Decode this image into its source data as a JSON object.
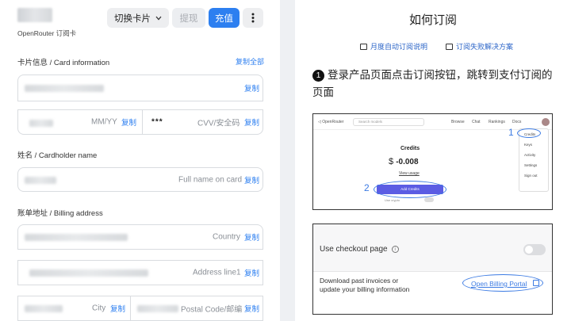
{
  "left": {
    "card_label": "OpenRouter 订阅卡",
    "buttons": {
      "switch_card": "切换卡片",
      "withdraw": "提现",
      "recharge": "充值"
    },
    "copy_all": "复制全部",
    "copy": "复制",
    "sections": {
      "card_info": "卡片信息 / Card information",
      "cardholder_name": "姓名 / Cardholder name",
      "billing_address": "账单地址 / Billing address"
    },
    "fields": {
      "expiry_placeholder": "MM/YY",
      "cvv_value": "***",
      "cvv_placeholder": "CVV/安全码",
      "name_placeholder": "Full name on card",
      "country_placeholder": "Country",
      "address_placeholder": "Address line1",
      "city_placeholder": "City",
      "postal_placeholder": "Postal Code/邮编"
    }
  },
  "right": {
    "title": "如何订阅",
    "links": [
      "月度自动订阅说明",
      "订阅失败解决方案"
    ],
    "step1_num": "❶",
    "step1_text": "登录产品页面点击订阅按钮，跳转到支付订阅的页面",
    "screenshot1": {
      "logo": "OpenRouter",
      "search": "Search models",
      "nav": [
        "Browse",
        "Chat",
        "Rankings",
        "Docs"
      ],
      "credits_label": "Credits",
      "currency": "$",
      "amount": "-0.008",
      "view_usage": "View usage",
      "add_credits": "Add Credits",
      "use_crypto": "Use crypto",
      "menu": [
        "Credits",
        "Keys",
        "Activity",
        "Settings",
        "Sign out"
      ],
      "marker_1": "1",
      "marker_2": "2"
    },
    "screenshot2": {
      "checkout_label": "Use checkout page",
      "info_icon": "i",
      "download_line1": "Download past invoices or",
      "download_line2": "update your billing information",
      "portal_link": "Open Billing Portal"
    }
  }
}
